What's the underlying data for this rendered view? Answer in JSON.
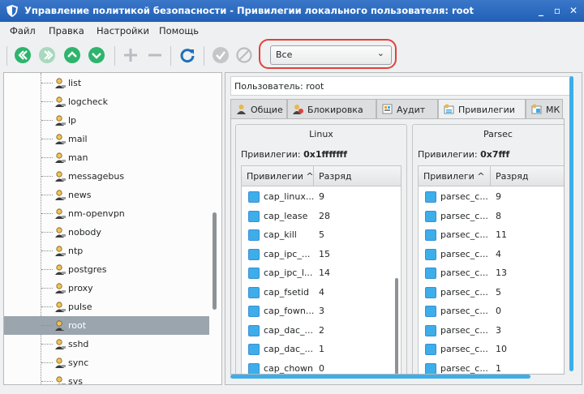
{
  "window": {
    "title": "Управление политикой безопасности - Привилегии локального пользователя: root",
    "controls": {
      "minimize": "_",
      "maximize": "▫",
      "close": "✕"
    },
    "accent": "#2b6cc4"
  },
  "menu": [
    "Файл",
    "Правка",
    "Настройки",
    "Помощь"
  ],
  "toolbar": {
    "buttons": [
      "first-icon",
      "prev-icon",
      "up-icon",
      "down-icon",
      "add-icon",
      "remove-icon",
      "refresh-icon",
      "apply-icon",
      "cancel-icon"
    ],
    "filter": {
      "value": "Все",
      "options": [
        "Все"
      ]
    }
  },
  "tree": {
    "items": [
      "list",
      "logcheck",
      "lp",
      "mail",
      "man",
      "messagebus",
      "news",
      "nm-openvpn",
      "nobody",
      "ntp",
      "postgres",
      "proxy",
      "pulse",
      "root",
      "sshd",
      "sync",
      "sys"
    ],
    "selected": "root"
  },
  "right": {
    "user_label": "Пользователь: root",
    "tabs": [
      "Общие",
      "Блокировка",
      "Аудит",
      "Привилегии",
      "МК"
    ],
    "active_tab": "Привилегии"
  },
  "linux": {
    "title": "Linux",
    "priv_label": "Привилегии:",
    "priv_value": "0x1fffffff",
    "col1": "Привилегии",
    "col2": "Разряд",
    "rows": [
      {
        "name": "cap_linux...",
        "bit": "9"
      },
      {
        "name": "cap_lease",
        "bit": "28"
      },
      {
        "name": "cap_kill",
        "bit": "5"
      },
      {
        "name": "cap_ipc_...",
        "bit": "15"
      },
      {
        "name": "cap_ipc_l...",
        "bit": "14"
      },
      {
        "name": "cap_fsetid",
        "bit": "4"
      },
      {
        "name": "cap_fown...",
        "bit": "3"
      },
      {
        "name": "cap_dac_...",
        "bit": "2"
      },
      {
        "name": "cap_dac_...",
        "bit": "1"
      },
      {
        "name": "cap_chown",
        "bit": "0"
      }
    ]
  },
  "parsec": {
    "title": "Parsec",
    "priv_label": "Привилегии:",
    "priv_value": "0x7fff",
    "col1": "Привилеги",
    "col2": "Разряд",
    "rows": [
      {
        "name": "parsec_c...",
        "bit": "9"
      },
      {
        "name": "parsec_c...",
        "bit": "8"
      },
      {
        "name": "parsec_c...",
        "bit": "11"
      },
      {
        "name": "parsec_c...",
        "bit": "4"
      },
      {
        "name": "parsec_c...",
        "bit": "13"
      },
      {
        "name": "parsec_c...",
        "bit": "5"
      },
      {
        "name": "parsec_c...",
        "bit": "0"
      },
      {
        "name": "parsec_c...",
        "bit": "3"
      },
      {
        "name": "parsec_c...",
        "bit": "10"
      },
      {
        "name": "parsec_c...",
        "bit": "1"
      }
    ]
  }
}
